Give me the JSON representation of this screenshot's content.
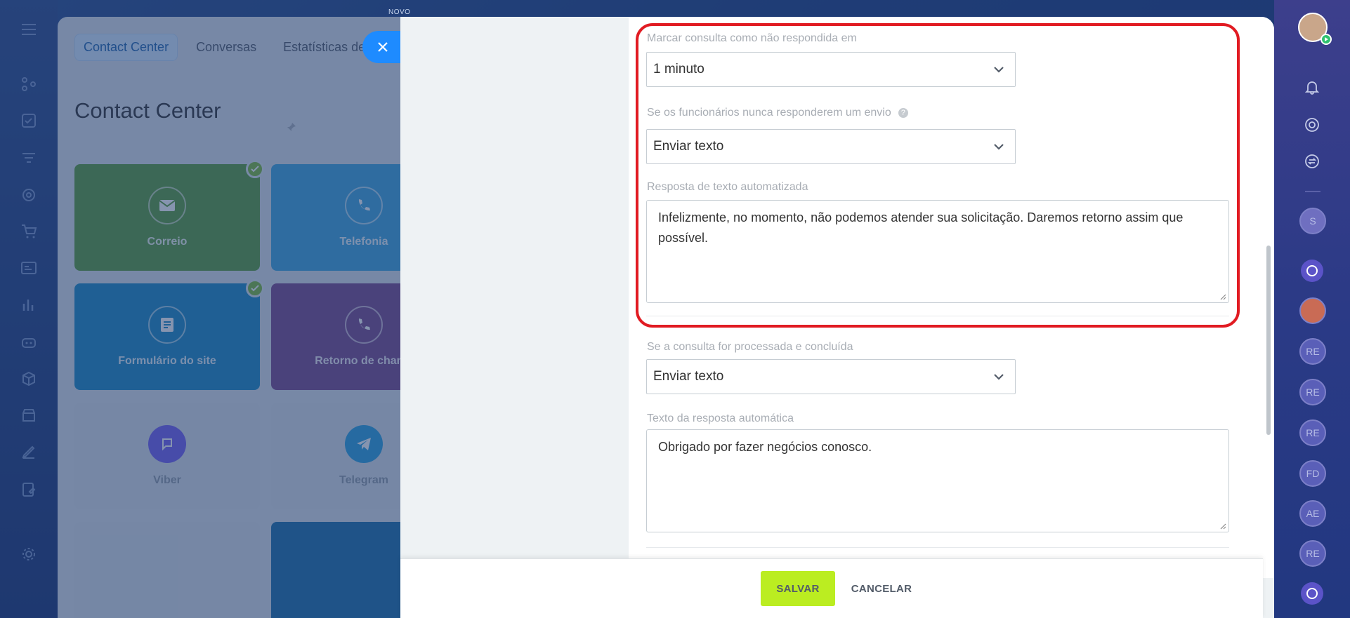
{
  "background_app": {
    "badge": "NOVO",
    "tabs": [
      {
        "label": "Contact Center",
        "active": true
      },
      {
        "label": "Conversas",
        "active": false
      },
      {
        "label": "Estatísticas de c",
        "active": false
      }
    ],
    "title": "Contact Center",
    "tiles": [
      {
        "label": "Correio",
        "icon": "mail-icon",
        "color": "#5c9e3a",
        "checked": true
      },
      {
        "label": "Telefonia",
        "icon": "phone-icon",
        "color": "#3fa6de",
        "checked": false
      },
      {
        "label": "Formulário do site",
        "icon": "form-icon",
        "color": "#1b8bc4",
        "checked": true
      },
      {
        "label": "Retorno de chama",
        "icon": "phone-callback-icon",
        "color": "#7a4a8c",
        "checked": false
      },
      {
        "label": "Viber",
        "icon": "viber-icon",
        "color": "#d4dce3",
        "checked": false
      },
      {
        "label": "Telegram",
        "icon": "telegram-icon",
        "color": "#d4dce3",
        "checked": false
      }
    ]
  },
  "form": {
    "unanswered": {
      "label": "Marcar consulta como não respondida em",
      "value": "1 minuto"
    },
    "never_respond": {
      "label": "Se os funcionários nunca responderem um envio",
      "help": "?",
      "value": "Enviar texto"
    },
    "auto_text": {
      "label": "Resposta de texto automatizada",
      "value": "Infelizmente, no momento, não podemos atender sua solicitação. Daremos retorno assim que possível."
    },
    "processed": {
      "label": "Se a consulta for processada e concluída",
      "value": "Enviar texto"
    },
    "auto_reply": {
      "label": "Texto da resposta automática",
      "value": "Obrigado por fazer negócios conosco."
    }
  },
  "footer": {
    "save_label": "SALVAR",
    "cancel_label": "CANCELAR"
  },
  "right_rail": {
    "avatars": [
      "S",
      "RE",
      "RE",
      "RE",
      "FD",
      "AE",
      "RE"
    ]
  },
  "colors": {
    "highlight": "#e11b22",
    "save_button": "#bbed21",
    "accent_blue": "#1e8bff"
  }
}
